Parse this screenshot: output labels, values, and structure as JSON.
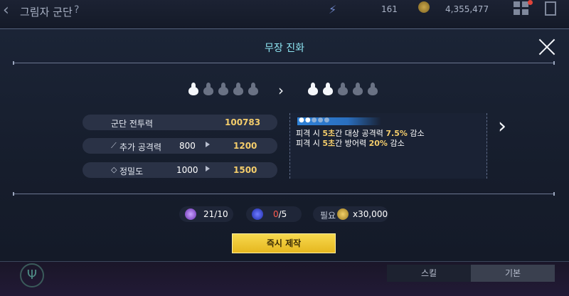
{
  "background": {
    "title": "그림자 군단",
    "help": "?",
    "energy_count": "161",
    "gold": "4,355,477",
    "tabs": [
      "스킬",
      "기본"
    ]
  },
  "modal": {
    "title": "무장 진화",
    "current_stars": 1,
    "next_stars": 2,
    "max_stars": 5,
    "stats": [
      {
        "label": "군단 전투력",
        "next": "100783"
      },
      {
        "label": "추가 공격력",
        "icon": "sword-icon",
        "current": "800",
        "next": "1200"
      },
      {
        "label": "정밀도",
        "icon": "diamond-icon",
        "current": "1000",
        "next": "1500"
      }
    ],
    "skill": {
      "level_filled": 2,
      "level_max": 5,
      "line1": {
        "p1": "피격 시 ",
        "h1": "5초",
        "p2": "간 대상 공격력 ",
        "h2": "7.5%",
        "p3": " 감소"
      },
      "line2": {
        "p1": "피격 시 ",
        "h1": "5초",
        "p2": "간 방어력 ",
        "h2": "20%",
        "p3": " 감소"
      }
    },
    "resources": {
      "material1": "21/10",
      "material2_have": "0",
      "material2_need": "/5",
      "cost_label": "필요",
      "cost": "x30,000"
    },
    "craft_button": "즉시 제작"
  },
  "colors": {
    "accent": "#8ee6f3",
    "highlight": "#f4cd6b",
    "button": "#f0c93a",
    "warning": "#ff5a4d"
  }
}
